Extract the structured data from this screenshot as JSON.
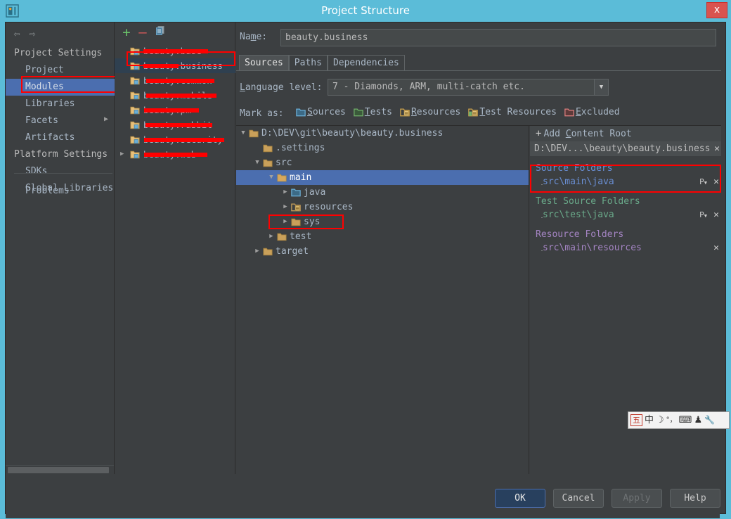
{
  "window": {
    "title": "Project Structure",
    "close_label": "x",
    "app_icon": "intellij-logo-icon"
  },
  "leftnav": {
    "back_icon": "⇦",
    "forward_icon": "⇨",
    "groups": [
      {
        "label": "Project Settings",
        "items": [
          {
            "label": "Project",
            "selected": false
          },
          {
            "label": "Modules",
            "selected": true
          },
          {
            "label": "Libraries",
            "selected": false
          },
          {
            "label": "Facets",
            "selected": false
          },
          {
            "label": "Artifacts",
            "selected": false
          }
        ]
      },
      {
        "label": "Platform Settings",
        "items": [
          {
            "label": "SDKs",
            "selected": false
          },
          {
            "label": "Global Libraries",
            "selected": false
          }
        ]
      }
    ],
    "problems_label": "Problems",
    "expand_icon": "▶"
  },
  "modules": {
    "toolbar": {
      "add_label": "+",
      "remove_label": "–",
      "copy_icon": "copy-icon"
    },
    "items": [
      {
        "label": "beauty.base",
        "redacted": true,
        "selected": false,
        "expandable": false
      },
      {
        "label": "beauty.business",
        "redacted": true,
        "selected": true,
        "expandable": false
      },
      {
        "label": "beauty.common",
        "redacted": true,
        "selected": false,
        "expandable": false
      },
      {
        "label": "beauty.mobile",
        "redacted": true,
        "selected": false,
        "expandable": false
      },
      {
        "label": "beauty.pm",
        "redacted": true,
        "selected": false,
        "expandable": false
      },
      {
        "label": "beauty.rabbit",
        "redacted": true,
        "selected": false,
        "expandable": false
      },
      {
        "label": "beauty.security",
        "redacted": true,
        "selected": false,
        "expandable": false
      },
      {
        "label": "beauty.web",
        "redacted": true,
        "selected": false,
        "expandable": true
      }
    ]
  },
  "main": {
    "name_label": "Name:",
    "name_value": "beauty.business",
    "name_placeholder": "",
    "tabs": [
      {
        "label": "Sources",
        "active": true
      },
      {
        "label": "Paths",
        "active": false
      },
      {
        "label": "Dependencies",
        "active": false
      }
    ],
    "language_level_label": "Language level:",
    "language_level_value": "7 - Diamonds, ARM, multi-catch etc.",
    "dropdown_icon": "▼",
    "mark_as_label": "Mark as:",
    "mark_as": [
      {
        "label": "Sources",
        "color": "#5b9ec4"
      },
      {
        "label": "Tests",
        "color": "#6aaa64"
      },
      {
        "label": "Resources",
        "color": "#d2a64c"
      },
      {
        "label": "Test Resources",
        "color": "#d2a64c"
      },
      {
        "label": "Excluded",
        "color": "#d96c6c"
      }
    ]
  },
  "tree": {
    "rows": [
      {
        "label": "D:\\DEV\\git\\beauty\\beauty.business",
        "depth": 0,
        "twisty": "▼",
        "icon": "folder-plain",
        "selected": false
      },
      {
        "label": ".settings",
        "depth": 1,
        "twisty": "",
        "icon": "folder-plain",
        "selected": false
      },
      {
        "label": "src",
        "depth": 1,
        "twisty": "▼",
        "icon": "folder-plain",
        "selected": false
      },
      {
        "label": "main",
        "depth": 2,
        "twisty": "▼",
        "icon": "folder-plain",
        "selected": true
      },
      {
        "label": "java",
        "depth": 3,
        "twisty": "▶",
        "icon": "folder-sources",
        "selected": false
      },
      {
        "label": "resources",
        "depth": 3,
        "twisty": "▶",
        "icon": "folder-resources",
        "selected": false
      },
      {
        "label": "sys",
        "depth": 3,
        "twisty": "▶",
        "icon": "folder-plain",
        "selected": false
      },
      {
        "label": "test",
        "depth": 2,
        "twisty": "▶",
        "icon": "folder-plain",
        "selected": false
      },
      {
        "label": "target",
        "depth": 1,
        "twisty": "▶",
        "icon": "folder-plain",
        "selected": false
      }
    ]
  },
  "roots": {
    "add_content_root_label": "Add Content Root",
    "add_icon": "+",
    "content_root_path": "D:\\DEV...\\beauty\\beauty.business",
    "remove_icon": "✕",
    "groups": [
      {
        "title": "Source Folders",
        "color": "#6a8fd4",
        "entries": [
          {
            "path": "src\\main\\java",
            "has_prefix_button": true,
            "prefix_label": "P",
            "remove_label": "✕"
          }
        ]
      },
      {
        "title": "Test Source Folders",
        "color": "#6aaa8a",
        "entries": [
          {
            "path": "src\\test\\java",
            "has_prefix_button": true,
            "prefix_label": "P",
            "remove_label": "✕"
          }
        ]
      },
      {
        "title": "Resource Folders",
        "color": "#a585c4",
        "entries": [
          {
            "path": "src\\main\\resources",
            "has_prefix_button": false,
            "prefix_label": "",
            "remove_label": "✕"
          }
        ]
      }
    ]
  },
  "ime": {
    "cells": [
      {
        "label": "五",
        "name": "wubi-mode-icon"
      },
      {
        "label": "中",
        "name": "chinese-mode-icon"
      },
      {
        "label": "☽",
        "name": "moon-icon"
      },
      {
        "label": "°，",
        "name": "punctuation-icon"
      },
      {
        "label": "⌨",
        "name": "soft-keyboard-icon"
      },
      {
        "label": "♟",
        "name": "user-dictionary-icon"
      },
      {
        "label": "🔧",
        "name": "tools-icon"
      }
    ]
  },
  "buttons": {
    "ok": "OK",
    "cancel": "Cancel",
    "apply": "Apply",
    "help": "Help"
  },
  "colors": {
    "titlebar": "#5bbcd8",
    "panel": "#3c3f41",
    "selection": "#4b6eaf",
    "redact": "#ff0000",
    "close": "#d9534f"
  }
}
